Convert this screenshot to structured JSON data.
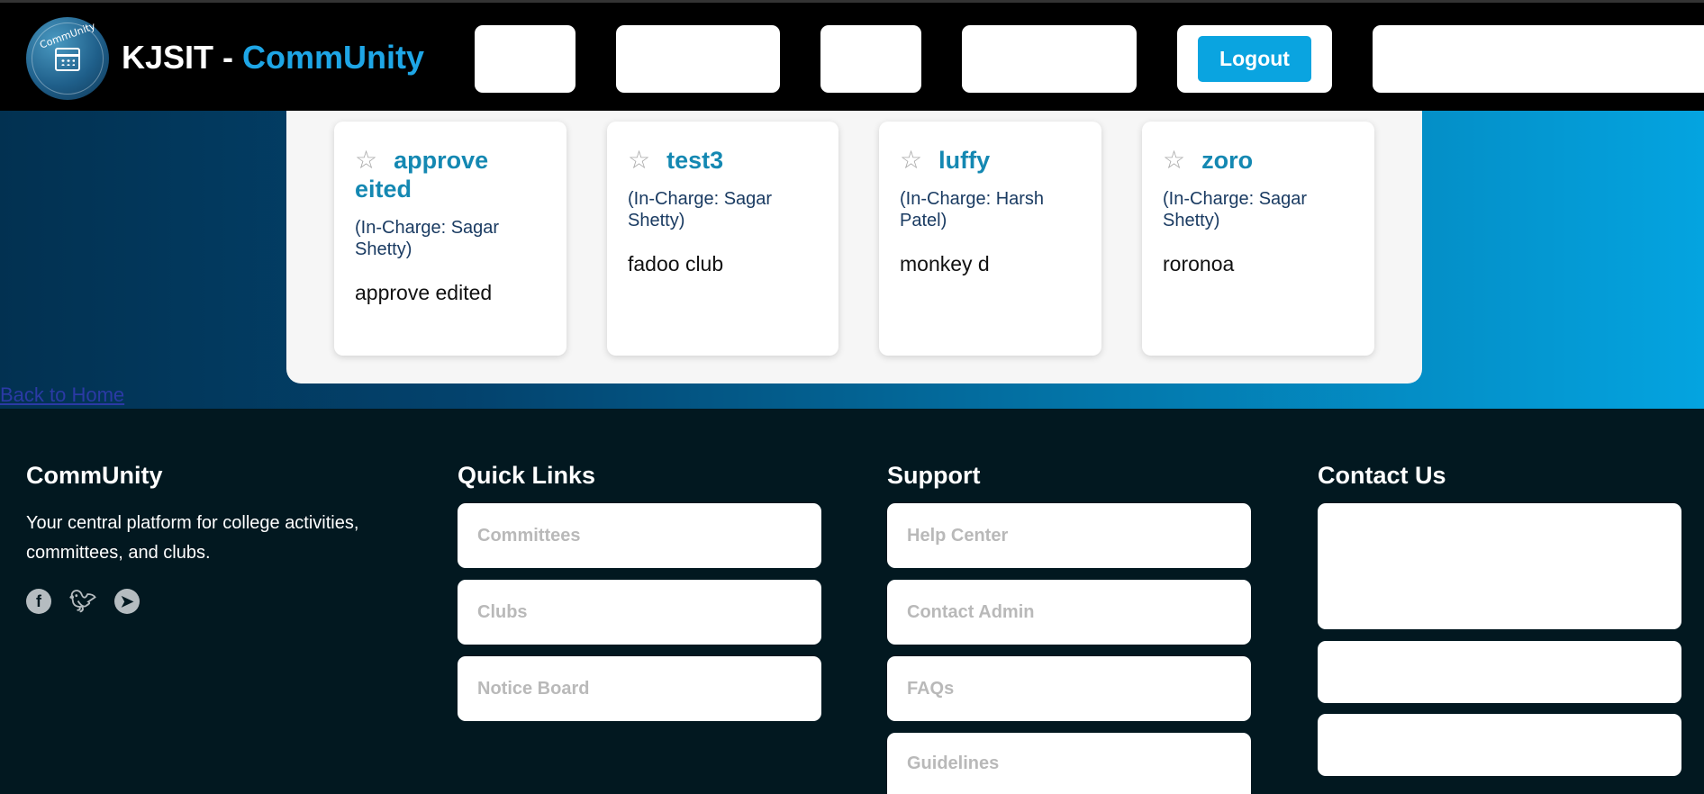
{
  "header": {
    "brand_prefix": "KJSIT - ",
    "brand_accent": "CommUnity",
    "logo_text": "CommUnity",
    "logout_label": "Logout"
  },
  "cards": [
    {
      "title": "approve eited",
      "incharge": "(In-Charge: Sagar Shetty)",
      "description": "approve edited"
    },
    {
      "title": "test3",
      "incharge": "(In-Charge: Sagar Shetty)",
      "description": "fadoo club"
    },
    {
      "title": "luffy",
      "incharge": "(In-Charge: Harsh Patel)",
      "description": "monkey d"
    },
    {
      "title": "zoro",
      "incharge": "(In-Charge: Sagar Shetty)",
      "description": "roronoa"
    }
  ],
  "back_link": "Back to Home",
  "footer": {
    "about_title": "CommUnity",
    "about_text": "Your central platform for college activities, committees, and clubs.",
    "social_icons": [
      "facebook-icon",
      "twitter-icon",
      "telegram-icon"
    ],
    "quick_links_title": "Quick Links",
    "quick_links": [
      "Committees",
      "Clubs",
      "Notice Board"
    ],
    "support_title": "Support",
    "support_links": [
      "Help Center",
      "Contact Admin",
      "FAQs",
      "Guidelines"
    ],
    "contact_title": "Contact Us"
  },
  "colors": {
    "accent": "#1ea6e6",
    "card_title": "#1488b2",
    "footer_bg": "#021820"
  }
}
